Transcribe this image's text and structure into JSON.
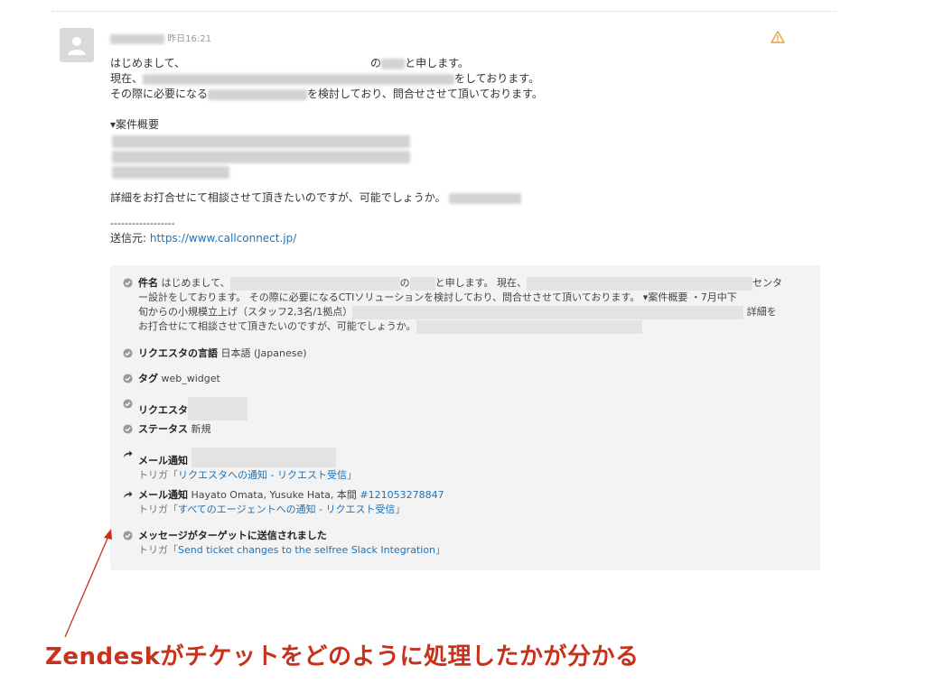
{
  "comment": {
    "timestamp": "昨日16:21",
    "body_line1_part1": "はじめまして、",
    "body_line1_part2": "の",
    "body_line1_part3": "と申します。",
    "body_line2_part1": "現在、",
    "body_line2_part2": "をしております。",
    "body_line3_part1": "その際に必要になる",
    "body_line3_part2": "を検討しており、問合せさせて頂いております。",
    "summary_heading": "▾案件概要",
    "consult_line": "詳細をお打合せにて相談させて頂きたいのですが、可能でしょうか。",
    "divider": "------------------",
    "sender_label": "送信元: ",
    "sender_link": "https://www.callconnect.jp/"
  },
  "events": {
    "subject": {
      "label": "件名",
      "seg1": "はじめまして、",
      "seg2": "の",
      "seg3": "と申します。 現在、",
      "seg4": "センタ",
      "line2": "ー設計をしております。 その際に必要になるCTIソリューションを検討しており、問合せさせて頂いております。 ▾案件概要 ・7月中下",
      "line3a": "旬からの小規模立上げ（スタッフ2,3名/1拠点）",
      "line3b": "詳細を",
      "line4": "お打合せにて相談させて頂きたいのですが、可能でしょうか。"
    },
    "language": {
      "label": "リクエスタの言語",
      "value": "日本語 (Japanese)"
    },
    "tag": {
      "label": "タグ",
      "value": "web_widget"
    },
    "requester": {
      "label": "リクエスタ"
    },
    "status": {
      "label": "ステータス",
      "value": "新規"
    },
    "mail1": {
      "label": "メール通知",
      "trigger_prefix": "トリガ「",
      "trigger_link": "リクエスタへの通知 - リクエスト受信",
      "trigger_suffix": "」"
    },
    "mail2": {
      "label": "メール通知",
      "recipients": "Hayato Omata, Yusuke Hata, 本間",
      "ticket_link": "#121053278847",
      "trigger_prefix": "トリガ「",
      "trigger_link": "すべてのエージェントへの通知 - リクエスト受信",
      "trigger_suffix": "」"
    },
    "target": {
      "label": "メッセージがターゲットに送信されました",
      "trigger_prefix": "トリガ「",
      "trigger_link": "Send ticket changes to the selfree Slack Integration",
      "trigger_suffix": "」"
    }
  },
  "annotation": {
    "caption": "Zendeskがチケットをどのように処理したかが分かる",
    "color": "#c8311c"
  },
  "icons": [
    "user-avatar-icon",
    "warning-icon",
    "check-circle-icon",
    "share-arrow-icon"
  ]
}
